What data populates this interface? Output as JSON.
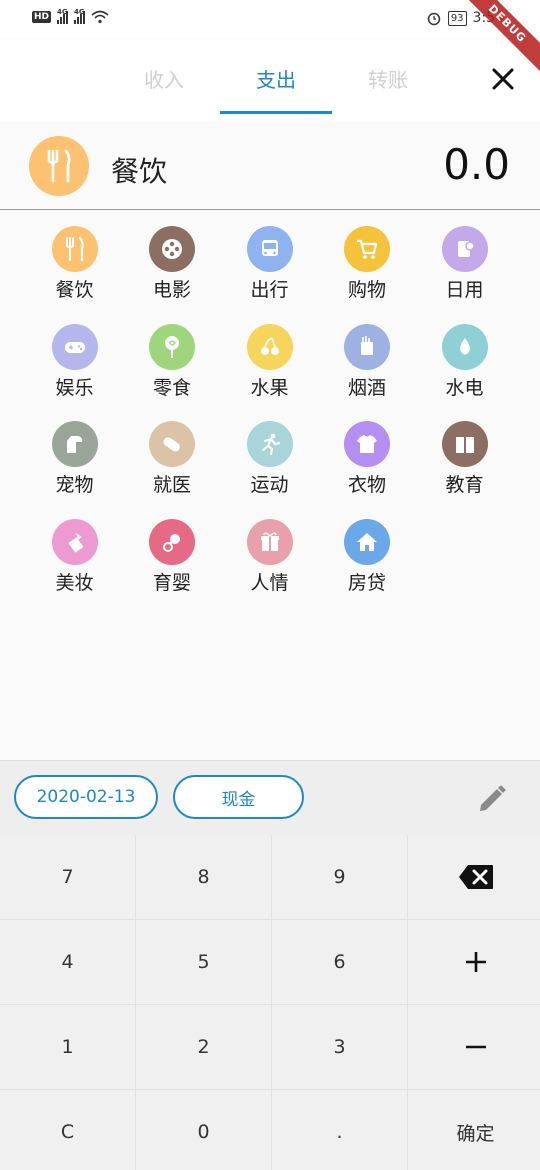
{
  "status": {
    "hd": "HD",
    "sim1": "4G",
    "sim2": "4G",
    "battery": "93",
    "time": "3:54"
  },
  "debug_label": "DEBUG",
  "tabs": [
    {
      "label": "收入"
    },
    {
      "label": "支出"
    },
    {
      "label": "转账"
    }
  ],
  "selected": {
    "name": "餐饮",
    "amount": "0.0",
    "color": "#fcc271"
  },
  "categories": [
    {
      "label": "餐饮",
      "icon": "fork-knife-icon",
      "color": "#fcc271"
    },
    {
      "label": "电影",
      "icon": "film-reel-icon",
      "color": "#8d6e63"
    },
    {
      "label": "出行",
      "icon": "bus-icon",
      "color": "#8fb3f0"
    },
    {
      "label": "购物",
      "icon": "cart-icon",
      "color": "#f5c33b"
    },
    {
      "label": "日用",
      "icon": "tissue-icon",
      "color": "#c3a8ea"
    },
    {
      "label": "娱乐",
      "icon": "gamepad-icon",
      "color": "#b4b6ec"
    },
    {
      "label": "零食",
      "icon": "lollipop-icon",
      "color": "#9fd67c"
    },
    {
      "label": "水果",
      "icon": "cherry-icon",
      "color": "#f5d55c"
    },
    {
      "label": "烟酒",
      "icon": "cigarette-icon",
      "color": "#9fb1e2"
    },
    {
      "label": "水电",
      "icon": "water-drop-icon",
      "color": "#8fd0d4"
    },
    {
      "label": "宠物",
      "icon": "pet-icon",
      "color": "#9aa59a"
    },
    {
      "label": "就医",
      "icon": "pill-icon",
      "color": "#dcc3a8"
    },
    {
      "label": "运动",
      "icon": "running-icon",
      "color": "#a8d4da"
    },
    {
      "label": "衣物",
      "icon": "tshirt-icon",
      "color": "#b48ef0"
    },
    {
      "label": "教育",
      "icon": "book-icon",
      "color": "#8d6e63"
    },
    {
      "label": "美妆",
      "icon": "lipstick-icon",
      "color": "#ee9ad2"
    },
    {
      "label": "育婴",
      "icon": "pacifier-icon",
      "color": "#e66a86"
    },
    {
      "label": "人情",
      "icon": "gift-icon",
      "color": "#e8a0ad"
    },
    {
      "label": "房贷",
      "icon": "house-icon",
      "color": "#6aa8e8"
    }
  ],
  "date": "2020-02-13",
  "account": "现金",
  "keypad": [
    "7",
    "8",
    "9",
    "backspace",
    "4",
    "5",
    "6",
    "+",
    "1",
    "2",
    "3",
    "−",
    "C",
    "0",
    ".",
    "确定"
  ],
  "accent": "#1e88c7"
}
